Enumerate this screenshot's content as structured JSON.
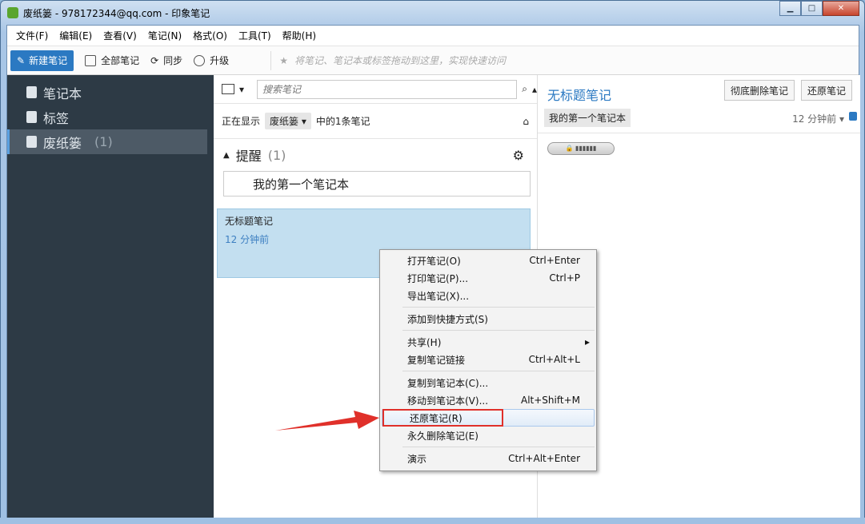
{
  "window": {
    "title": "废纸篓 - 978172344@qq.com - 印象笔记",
    "controls": {
      "minimize": "▁",
      "maximize": "□",
      "close": "✕"
    }
  },
  "menu": [
    "文件(F)",
    "编辑(E)",
    "查看(V)",
    "笔记(N)",
    "格式(O)",
    "工具(T)",
    "帮助(H)"
  ],
  "toolbar": {
    "new_note": "新建笔记",
    "all_notes": "全部笔记",
    "sync": "同步",
    "upgrade": "升级",
    "shortcut_hint": "将笔记、笔记本或标签拖动到这里，实现快速访问"
  },
  "sidebar": {
    "items": [
      {
        "label": "笔记本",
        "icon": "notebook-icon"
      },
      {
        "label": "标签",
        "icon": "tag-icon"
      },
      {
        "label": "废纸篓",
        "icon": "trash-icon",
        "count": "(1)",
        "active": true
      }
    ]
  },
  "list": {
    "search_placeholder": "搜索笔记",
    "showing_prefix": "正在显示",
    "showing_filter": "废纸篓",
    "showing_suffix": "中的1条笔记",
    "reminder_label": "提醒",
    "reminder_count": "(1)",
    "reminder_note": "我的第一个笔记本",
    "note": {
      "title": "无标题笔记",
      "time": "12 分钟前"
    }
  },
  "detail": {
    "title": "无标题笔记",
    "delete_button": "彻底删除笔记",
    "restore_button": "还原笔记",
    "notebook": "我的第一个笔记本",
    "time": "12 分钟前"
  },
  "context_menu": {
    "groups": [
      [
        {
          "label": "打开笔记(O)",
          "shortcut": "Ctrl+Enter"
        },
        {
          "label": "打印笔记(P)...",
          "shortcut": "Ctrl+P"
        },
        {
          "label": "导出笔记(X)...",
          "shortcut": ""
        }
      ],
      [
        {
          "label": "添加到快捷方式(S)",
          "shortcut": ""
        }
      ],
      [
        {
          "label": "共享(H)",
          "shortcut": "",
          "submenu": true
        },
        {
          "label": "复制笔记链接",
          "shortcut": "Ctrl+Alt+L"
        }
      ],
      [
        {
          "label": "复制到笔记本(C)...",
          "shortcut": ""
        },
        {
          "label": "移动到笔记本(V)...",
          "shortcut": "Alt+Shift+M"
        },
        {
          "label": "还原笔记(R)",
          "shortcut": "",
          "highlighted": true
        },
        {
          "label": "永久删除笔记(E)",
          "shortcut": ""
        }
      ],
      [
        {
          "label": "演示",
          "shortcut": "Ctrl+Alt+Enter"
        }
      ]
    ]
  },
  "colors": {
    "accent": "#2b79c2",
    "sidebar_bg": "#2d3a45",
    "highlight_box": "#e0302a",
    "note_selected": "#c3dff0"
  }
}
